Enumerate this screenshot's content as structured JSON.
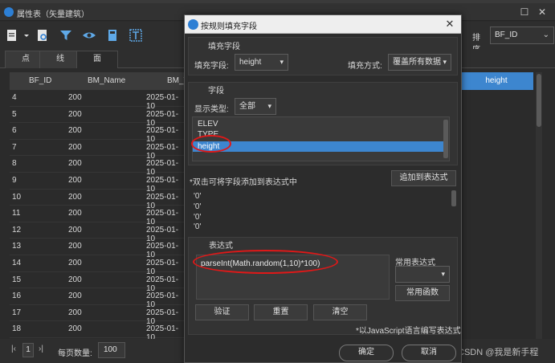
{
  "background_window": {
    "title": "属性表（矢量建筑）",
    "layer_tabs": [
      "点",
      "线",
      "面"
    ],
    "active_tab": "面",
    "sort_label": "排序",
    "sort_value": "BF_ID",
    "columns": [
      "BF_ID",
      "BM_Name",
      "BM_T"
    ],
    "rows": [
      {
        "id": "4",
        "name": "200",
        "time": "2025-01-10"
      },
      {
        "id": "5",
        "name": "200",
        "time": "2025-01-10"
      },
      {
        "id": "6",
        "name": "200",
        "time": "2025-01-10"
      },
      {
        "id": "7",
        "name": "200",
        "time": "2025-01-10"
      },
      {
        "id": "8",
        "name": "200",
        "time": "2025-01-10"
      },
      {
        "id": "9",
        "name": "200",
        "time": "2025-01-10"
      },
      {
        "id": "10",
        "name": "200",
        "time": "2025-01-10"
      },
      {
        "id": "11",
        "name": "200",
        "time": "2025-01-10"
      },
      {
        "id": "12",
        "name": "200",
        "time": "2025-01-10"
      },
      {
        "id": "13",
        "name": "200",
        "time": "2025-01-10"
      },
      {
        "id": "14",
        "name": "200",
        "time": "2025-01-10"
      },
      {
        "id": "15",
        "name": "200",
        "time": "2025-01-10"
      },
      {
        "id": "16",
        "name": "200",
        "time": "2025-01-10"
      },
      {
        "id": "17",
        "name": "200",
        "time": "2025-01-10"
      },
      {
        "id": "18",
        "name": "200",
        "time": "2025-01-10"
      }
    ],
    "highlighted_column": "height",
    "pager": {
      "page": "1",
      "page_size_label": "每页数量:",
      "page_size": "100"
    },
    "toolbar_icons": [
      "export-icon",
      "dropdown-arrow-icon",
      "search-doc-icon",
      "filter-icon",
      "eye-icon",
      "calculator-icon",
      "text-field-icon"
    ]
  },
  "dialog": {
    "title": "按规则填充字段",
    "fill_group": {
      "title": "填充字段",
      "field_label": "填充字段:",
      "field_value": "height",
      "mode_label": "填充方式:",
      "mode_value": "覆盖所有数据"
    },
    "field_group": {
      "title": "字段",
      "type_label": "显示类型:",
      "type_value": "全部",
      "fields": [
        "ELEV",
        "TYPE",
        "height"
      ],
      "selected_field": "height",
      "hint": "*双击可将字段添加到表达式中",
      "add_button": "追加到表达式"
    },
    "values": [
      "'0'",
      "'0'",
      "'0'",
      "'0'"
    ],
    "expr_group": {
      "title": "表达式",
      "expression": "parseInt(Math.random(1,10)*100)",
      "common_expr_label": "常用表达式",
      "common_expr_value": "",
      "common_func_button": "常用函数",
      "validate_button": "验证",
      "reset_button": "重置",
      "clear_button": "清空",
      "note": "*以JavaScript语言编写表达式"
    },
    "ok_button": "确定",
    "cancel_button": "取消"
  },
  "watermark": "CSDN @我是新手程",
  "colors": {
    "selection": "#3d86cf",
    "annotation": "#e01818"
  }
}
